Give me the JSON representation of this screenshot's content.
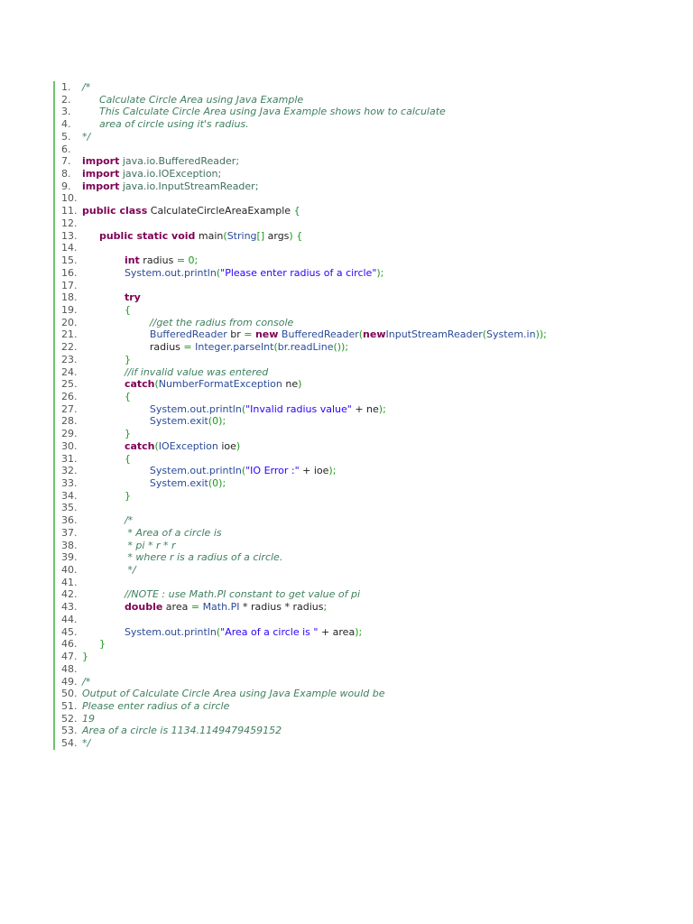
{
  "lines": [
    {
      "n": "1.",
      "tokens": [
        [
          "c",
          "/*"
        ]
      ]
    },
    {
      "n": "2.",
      "tokens": [
        [
          "c",
          "\t\tCalculate Circle Area using Java Example"
        ]
      ]
    },
    {
      "n": "3.",
      "tokens": [
        [
          "c",
          "\t\tThis Calculate Circle Area using Java Example shows how to calculate"
        ]
      ]
    },
    {
      "n": "4.",
      "tokens": [
        [
          "c",
          "\t\tarea of circle using it's radius."
        ]
      ]
    },
    {
      "n": "5.",
      "tokens": [
        [
          "c",
          "*/"
        ]
      ]
    },
    {
      "n": "6.",
      "tokens": []
    },
    {
      "n": "7.",
      "tokens": [
        [
          "k",
          "import"
        ],
        [
          "i",
          " java.io.BufferedReader;"
        ]
      ]
    },
    {
      "n": "8.",
      "tokens": [
        [
          "k",
          "import"
        ],
        [
          "i",
          " java.io.IOException;"
        ]
      ]
    },
    {
      "n": "9.",
      "tokens": [
        [
          "k",
          "import"
        ],
        [
          "i",
          " java.io.InputStreamReader;"
        ]
      ]
    },
    {
      "n": "10.",
      "tokens": []
    },
    {
      "n": "11.",
      "tokens": [
        [
          "k",
          "public class"
        ],
        [
          "x",
          " CalculateCircleAreaExample "
        ],
        [
          "p",
          "{"
        ]
      ]
    },
    {
      "n": "12.",
      "tokens": []
    },
    {
      "n": "13.",
      "tokens": [
        [
          "x",
          "\t\t"
        ],
        [
          "k",
          "public static void"
        ],
        [
          "x",
          " main"
        ],
        [
          "p",
          "("
        ],
        [
          "t",
          "String"
        ],
        [
          "p",
          "[]"
        ],
        [
          "x",
          " args"
        ],
        [
          "p",
          ")"
        ],
        [
          "x",
          " "
        ],
        [
          "p",
          "{"
        ]
      ]
    },
    {
      "n": "14.",
      "tokens": []
    },
    {
      "n": "15.",
      "tokens": [
        [
          "x",
          "\t\t\t\t"
        ],
        [
          "k",
          "int"
        ],
        [
          "x",
          " radius "
        ],
        [
          "p",
          "="
        ],
        [
          "x",
          " "
        ],
        [
          "n",
          "0"
        ],
        [
          "p",
          ";"
        ]
      ]
    },
    {
      "n": "16.",
      "tokens": [
        [
          "x",
          "\t\t\t\t"
        ],
        [
          "t",
          "System.out.println"
        ],
        [
          "p",
          "("
        ],
        [
          "s",
          "\"Please enter radius of a circle\""
        ],
        [
          "p",
          ");"
        ]
      ]
    },
    {
      "n": "17.",
      "tokens": []
    },
    {
      "n": "18.",
      "tokens": [
        [
          "x",
          "\t\t\t\t"
        ],
        [
          "k",
          "try"
        ]
      ]
    },
    {
      "n": "19.",
      "tokens": [
        [
          "x",
          "\t\t\t\t"
        ],
        [
          "p",
          "{"
        ]
      ]
    },
    {
      "n": "20.",
      "tokens": [
        [
          "x",
          "\t\t\t\t\t\t"
        ],
        [
          "c",
          "//get the radius from console"
        ]
      ]
    },
    {
      "n": "21.",
      "tokens": [
        [
          "x",
          "\t\t\t\t\t\t"
        ],
        [
          "t",
          "BufferedReader"
        ],
        [
          "x",
          " br "
        ],
        [
          "p",
          "="
        ],
        [
          "x",
          " "
        ],
        [
          "k",
          "new"
        ],
        [
          "x",
          " "
        ],
        [
          "t",
          "BufferedReader"
        ],
        [
          "p",
          "("
        ],
        [
          "k",
          "new"
        ],
        [
          "t",
          "InputStreamReader"
        ],
        [
          "p",
          "("
        ],
        [
          "t",
          "System.in"
        ],
        [
          "p",
          "));"
        ]
      ]
    },
    {
      "n": "22.",
      "tokens": [
        [
          "x",
          "\t\t\t\t\t\tradius "
        ],
        [
          "p",
          "="
        ],
        [
          "x",
          " "
        ],
        [
          "t",
          "Integer.parseInt"
        ],
        [
          "p",
          "("
        ],
        [
          "t",
          "br.readLine"
        ],
        [
          "p",
          "());"
        ]
      ]
    },
    {
      "n": "23.",
      "tokens": [
        [
          "x",
          "\t\t\t\t"
        ],
        [
          "p",
          "}"
        ]
      ]
    },
    {
      "n": "24.",
      "tokens": [
        [
          "x",
          "\t\t\t\t"
        ],
        [
          "c",
          "//if invalid value was entered"
        ]
      ]
    },
    {
      "n": "25.",
      "tokens": [
        [
          "x",
          "\t\t\t\t"
        ],
        [
          "k",
          "catch"
        ],
        [
          "p",
          "("
        ],
        [
          "t",
          "NumberFormatException"
        ],
        [
          "x",
          " ne"
        ],
        [
          "p",
          ")"
        ]
      ]
    },
    {
      "n": "26.",
      "tokens": [
        [
          "x",
          "\t\t\t\t"
        ],
        [
          "p",
          "{"
        ]
      ]
    },
    {
      "n": "27.",
      "tokens": [
        [
          "x",
          "\t\t\t\t\t\t"
        ],
        [
          "t",
          "System.out.println"
        ],
        [
          "p",
          "("
        ],
        [
          "s",
          "\"Invalid radius value\""
        ],
        [
          "x",
          " + ne"
        ],
        [
          "p",
          ");"
        ]
      ]
    },
    {
      "n": "28.",
      "tokens": [
        [
          "x",
          "\t\t\t\t\t\t"
        ],
        [
          "t",
          "System.exit"
        ],
        [
          "p",
          "("
        ],
        [
          "n",
          "0"
        ],
        [
          "p",
          ");"
        ]
      ]
    },
    {
      "n": "29.",
      "tokens": [
        [
          "x",
          "\t\t\t\t"
        ],
        [
          "p",
          "}"
        ]
      ]
    },
    {
      "n": "30.",
      "tokens": [
        [
          "x",
          "\t\t\t\t"
        ],
        [
          "k",
          "catch"
        ],
        [
          "p",
          "("
        ],
        [
          "t",
          "IOException"
        ],
        [
          "x",
          " ioe"
        ],
        [
          "p",
          ")"
        ]
      ]
    },
    {
      "n": "31.",
      "tokens": [
        [
          "x",
          "\t\t\t\t"
        ],
        [
          "p",
          "{"
        ]
      ]
    },
    {
      "n": "32.",
      "tokens": [
        [
          "x",
          "\t\t\t\t\t\t"
        ],
        [
          "t",
          "System.out.println"
        ],
        [
          "p",
          "("
        ],
        [
          "s",
          "\"IO Error :\""
        ],
        [
          "x",
          " + ioe"
        ],
        [
          "p",
          ");"
        ]
      ]
    },
    {
      "n": "33.",
      "tokens": [
        [
          "x",
          "\t\t\t\t\t\t"
        ],
        [
          "t",
          "System.exit"
        ],
        [
          "p",
          "("
        ],
        [
          "n",
          "0"
        ],
        [
          "p",
          ");"
        ]
      ]
    },
    {
      "n": "34.",
      "tokens": [
        [
          "x",
          "\t\t\t\t"
        ],
        [
          "p",
          "}"
        ]
      ]
    },
    {
      "n": "35.",
      "tokens": []
    },
    {
      "n": "36.",
      "tokens": [
        [
          "x",
          "\t\t\t\t"
        ],
        [
          "c",
          "/*"
        ]
      ]
    },
    {
      "n": "37.",
      "tokens": [
        [
          "x",
          "\t\t\t\t"
        ],
        [
          "c",
          " * Area of a circle is"
        ]
      ]
    },
    {
      "n": "38.",
      "tokens": [
        [
          "x",
          "\t\t\t\t"
        ],
        [
          "c",
          " * pi * r * r"
        ]
      ]
    },
    {
      "n": "39.",
      "tokens": [
        [
          "x",
          "\t\t\t\t"
        ],
        [
          "c",
          " * where r is a radius of a circle."
        ]
      ]
    },
    {
      "n": "40.",
      "tokens": [
        [
          "x",
          "\t\t\t\t"
        ],
        [
          "c",
          " */"
        ]
      ]
    },
    {
      "n": "41.",
      "tokens": []
    },
    {
      "n": "42.",
      "tokens": [
        [
          "x",
          "\t\t\t\t"
        ],
        [
          "c",
          "//NOTE : use Math.PI constant to get value of pi"
        ]
      ]
    },
    {
      "n": "43.",
      "tokens": [
        [
          "x",
          "\t\t\t\t"
        ],
        [
          "k",
          "double"
        ],
        [
          "x",
          " area "
        ],
        [
          "p",
          "="
        ],
        [
          "x",
          " "
        ],
        [
          "t",
          "Math.PI"
        ],
        [
          "x",
          " * radius * radius"
        ],
        [
          "p",
          ";"
        ]
      ]
    },
    {
      "n": "44.",
      "tokens": []
    },
    {
      "n": "45.",
      "tokens": [
        [
          "x",
          "\t\t\t\t"
        ],
        [
          "t",
          "System.out.println"
        ],
        [
          "p",
          "("
        ],
        [
          "s",
          "\"Area of a circle is \""
        ],
        [
          "x",
          " + area"
        ],
        [
          "p",
          ");"
        ]
      ]
    },
    {
      "n": "46.",
      "tokens": [
        [
          "x",
          "\t\t"
        ],
        [
          "p",
          "}"
        ]
      ]
    },
    {
      "n": "47.",
      "tokens": [
        [
          "p",
          "}"
        ]
      ]
    },
    {
      "n": "48.",
      "tokens": []
    },
    {
      "n": "49.",
      "tokens": [
        [
          "c",
          "/*"
        ]
      ]
    },
    {
      "n": "50.",
      "tokens": [
        [
          "c",
          "Output of Calculate Circle Area using Java Example would be"
        ]
      ]
    },
    {
      "n": "51.",
      "tokens": [
        [
          "c",
          "Please enter radius of a circle"
        ]
      ]
    },
    {
      "n": "52.",
      "tokens": [
        [
          "c",
          "19"
        ]
      ]
    },
    {
      "n": "53.",
      "tokens": [
        [
          "c",
          "Area of a circle is 1134.1149479459152"
        ]
      ]
    },
    {
      "n": "54.",
      "tokens": [
        [
          "c",
          "*/"
        ]
      ]
    }
  ]
}
